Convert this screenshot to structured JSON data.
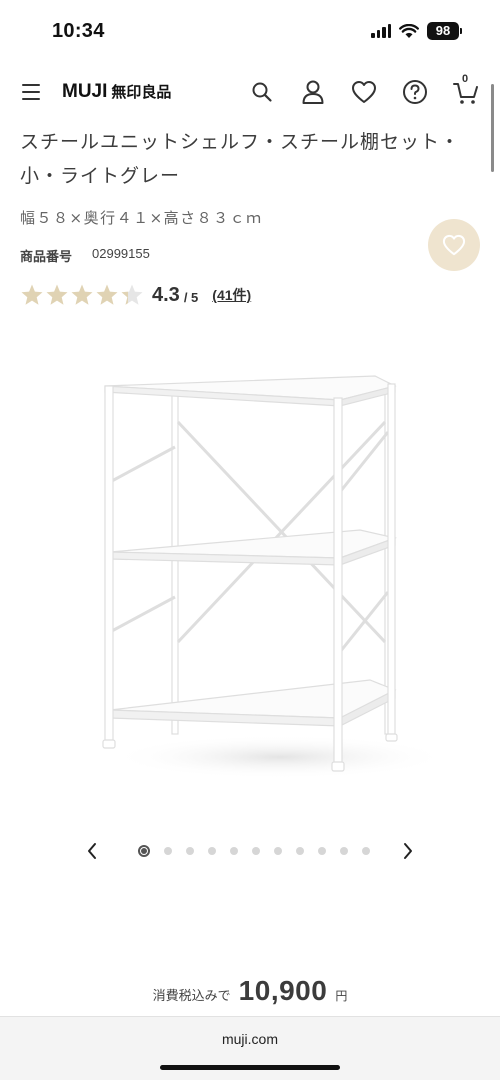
{
  "status_bar": {
    "time": "10:34",
    "battery": "98",
    "icons": [
      "signal-icon",
      "wifi-icon",
      "battery-icon"
    ]
  },
  "header": {
    "logo_latin": "MUJI",
    "logo_japanese": "無印良品",
    "icons": [
      "menu-icon",
      "search-icon",
      "user-icon",
      "heart-icon",
      "help-icon",
      "cart-icon"
    ],
    "cart_count": "0"
  },
  "product": {
    "title": "スチールユニットシェルフ・スチール棚セット・小・ライトグレー",
    "size": "幅５８×奥行４１×高さ８３ｃｍ",
    "code_label": "商品番号",
    "code_value": "02999155",
    "rating_value": "4.3",
    "rating_max": "/ 5",
    "rating_fraction": 0.86,
    "review_count": "(41件)"
  },
  "carousel": {
    "total": 11,
    "active_index": 0
  },
  "price": {
    "label": "消費税込みで",
    "value": "10,900",
    "unit": "円"
  },
  "browser": {
    "url": "muji.com"
  },
  "colors": {
    "accent_fav": "#efe4cf",
    "star_fill": "#e0d3b4",
    "star_empty": "#e6e6e6"
  }
}
